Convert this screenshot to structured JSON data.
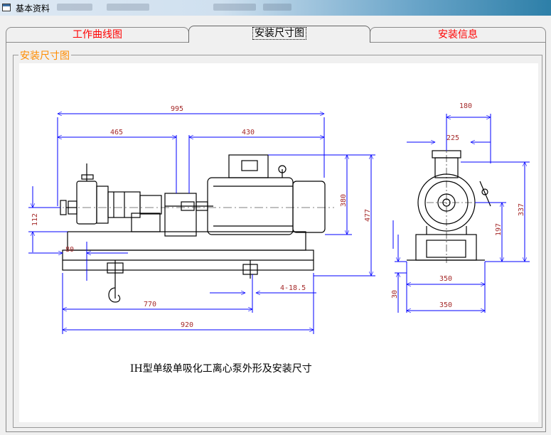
{
  "window": {
    "title": "基本资料"
  },
  "tabs": [
    {
      "label": "工作曲线图"
    },
    {
      "label": "安装尺寸图"
    },
    {
      "label": "安装信息"
    }
  ],
  "group": {
    "label": "安装尺寸图"
  },
  "drawing": {
    "caption": "IH型单级单吸化工离心泵外形及安装尺寸",
    "dims": {
      "d995": "995",
      "d465": "465",
      "d430": "430",
      "d112": "112",
      "d80": "80",
      "d380": "380",
      "d477": "477",
      "d418": "4-18.5",
      "d770": "770",
      "d920": "920",
      "d180": "180",
      "d225": "225",
      "d197": "197",
      "d337": "337",
      "d350a": "350",
      "d350b": "350",
      "d30": "30"
    }
  },
  "colors": {
    "dimension": "#0000ff",
    "dimension_text": "#a52a2a",
    "tab_text": "#ff0000",
    "group_label": "#ff8c00"
  }
}
